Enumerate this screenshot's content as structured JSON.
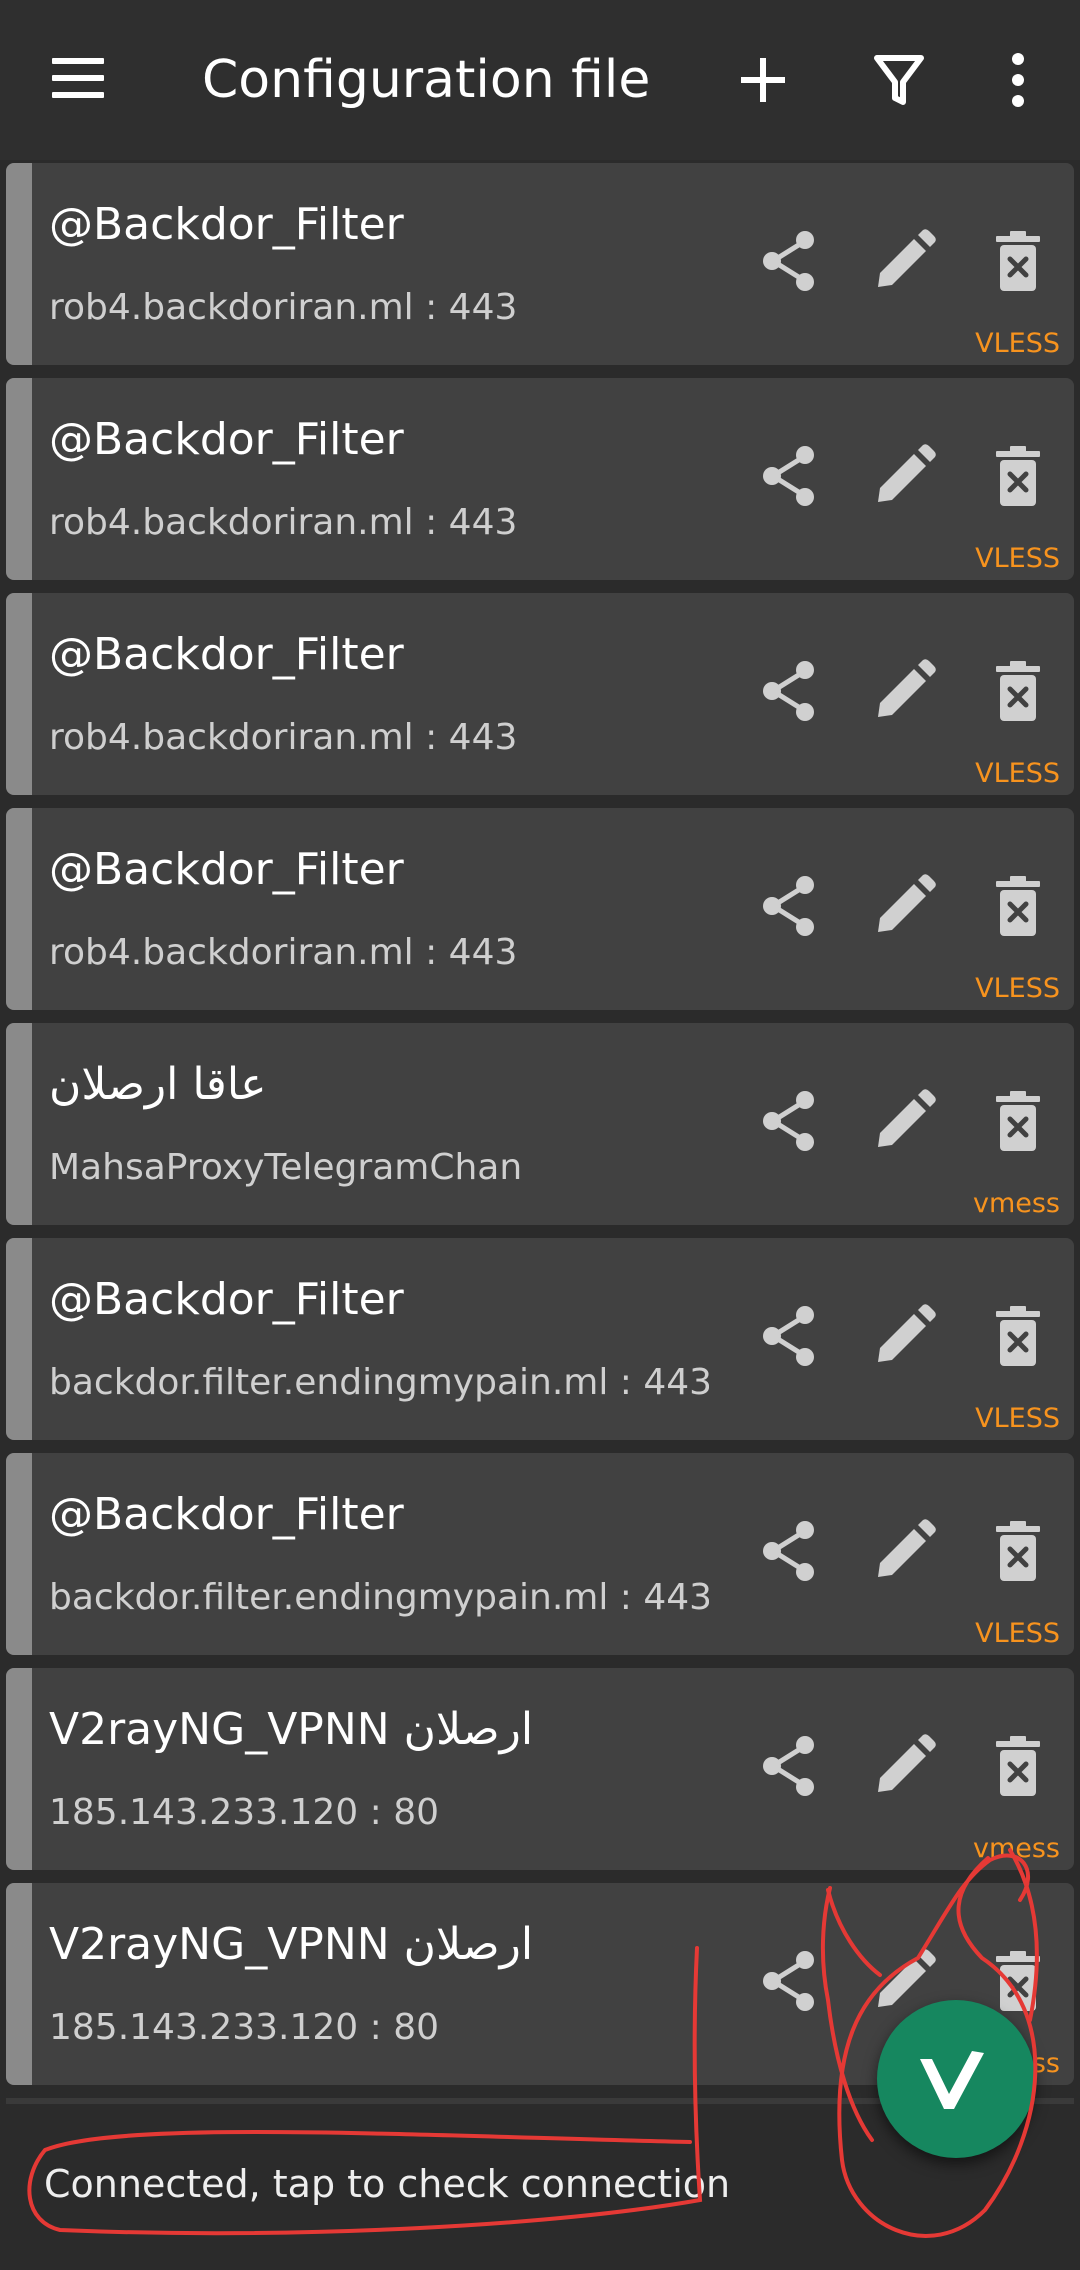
{
  "app_bar": {
    "title": "Configuration file",
    "menu_icon": "hamburger-menu-icon",
    "actions": [
      "add-icon",
      "filter-icon",
      "more-vert-icon"
    ]
  },
  "servers": [
    {
      "name": "@Backdor_Filter",
      "address": "rob4.backdoriran.ml : 443",
      "protocol": "VLESS"
    },
    {
      "name": "@Backdor_Filter",
      "address": "rob4.backdoriran.ml : 443",
      "protocol": "VLESS"
    },
    {
      "name": "@Backdor_Filter",
      "address": "rob4.backdoriran.ml : 443",
      "protocol": "VLESS"
    },
    {
      "name": "@Backdor_Filter",
      "address": "rob4.backdoriran.ml : 443",
      "protocol": "VLESS"
    },
    {
      "name": "عاقا ارصلان",
      "address": "MahsaProxyTelegramChan",
      "protocol": "vmess"
    },
    {
      "name": "@Backdor_Filter",
      "address": "backdor.filter.endingmypain.ml : 443",
      "protocol": "VLESS"
    },
    {
      "name": "@Backdor_Filter",
      "address": "backdor.filter.endingmypain.ml : 443",
      "protocol": "VLESS"
    },
    {
      "name": "V2rayNG_VPNN ارصلان",
      "address": "185.143.233.120 : 80",
      "protocol": "vmess"
    },
    {
      "name": "V2rayNG_VPNN ارصلان",
      "address": "185.143.233.120 : 80",
      "protocol": "vmess"
    }
  ],
  "status": {
    "text": "Connected, tap to check connection"
  },
  "fab": {
    "icon": "v2ray-logo-icon",
    "color": "#16875f"
  },
  "colors": {
    "background": "#2b2b2b",
    "card": "#414141",
    "card_indicator": "#8a8a8a",
    "protocol": "#f7931e",
    "annotation": "#e53935"
  }
}
